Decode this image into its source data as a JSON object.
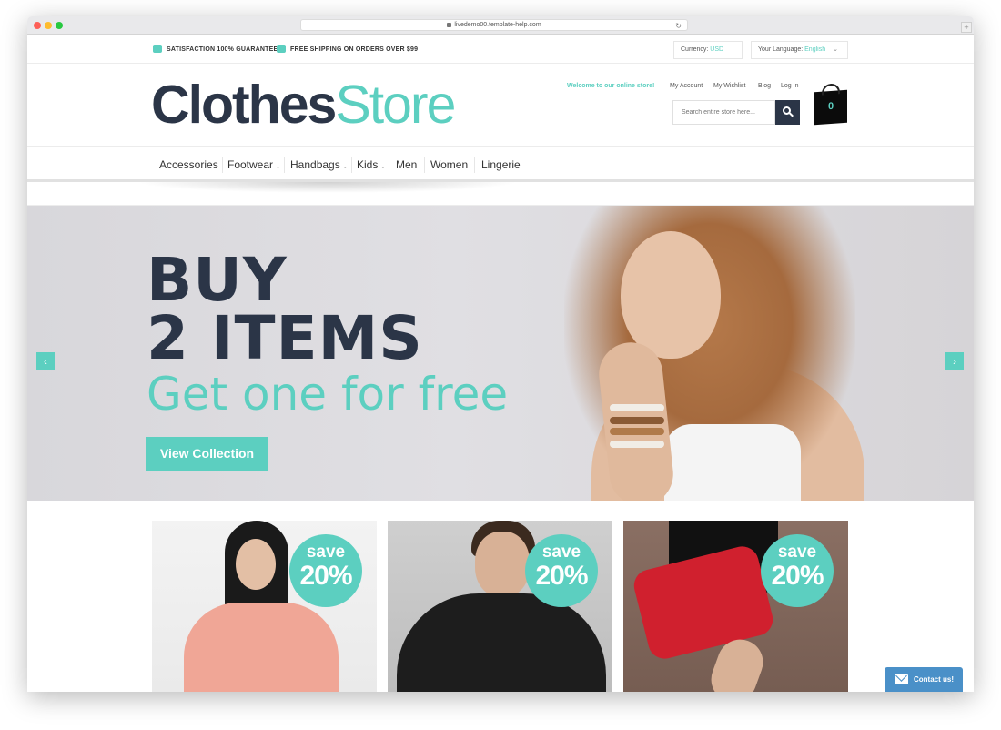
{
  "browser": {
    "url": "livedemo00.template-help.com"
  },
  "topbar": {
    "satisfaction": "SATISFACTION 100% GUARANTEED",
    "shipping": "FREE SHIPPING ON ORDERS OVER $99",
    "currency_label": "Currency:",
    "currency_value": "USD",
    "language_label": "Your Language:",
    "language_value": "English"
  },
  "header": {
    "logo_part1": "Clothes",
    "logo_part2": "Store",
    "welcome": "Welcome to our online store!",
    "links": [
      "My Account",
      "My Wishlist",
      "Blog",
      "Log In"
    ],
    "search_placeholder": "Search entire store here...",
    "cart_count": "0"
  },
  "nav": {
    "items": [
      {
        "label": "Accessories",
        "has_dropdown": false
      },
      {
        "label": "Footwear",
        "has_dropdown": true
      },
      {
        "label": "Handbags",
        "has_dropdown": true
      },
      {
        "label": "Kids",
        "has_dropdown": true
      },
      {
        "label": "Men",
        "has_dropdown": false
      },
      {
        "label": "Women",
        "has_dropdown": false
      },
      {
        "label": "Lingerie",
        "has_dropdown": false
      }
    ]
  },
  "slider": {
    "line1": "BUY",
    "line2": "2 ITEMS",
    "line3": "Get one for free",
    "cta": "View Collection",
    "prev_icon": "chevron-left-icon",
    "next_icon": "chevron-right-icon"
  },
  "promos": [
    {
      "badge_top": "save",
      "badge_value": "20%"
    },
    {
      "badge_top": "save",
      "badge_value": "20%"
    },
    {
      "badge_top": "save",
      "badge_value": "20%"
    }
  ],
  "contact": {
    "label": "Contact us!"
  },
  "colors": {
    "accent": "#5ccfc0",
    "dark": "#2b3547",
    "contact": "#4a90c8"
  }
}
